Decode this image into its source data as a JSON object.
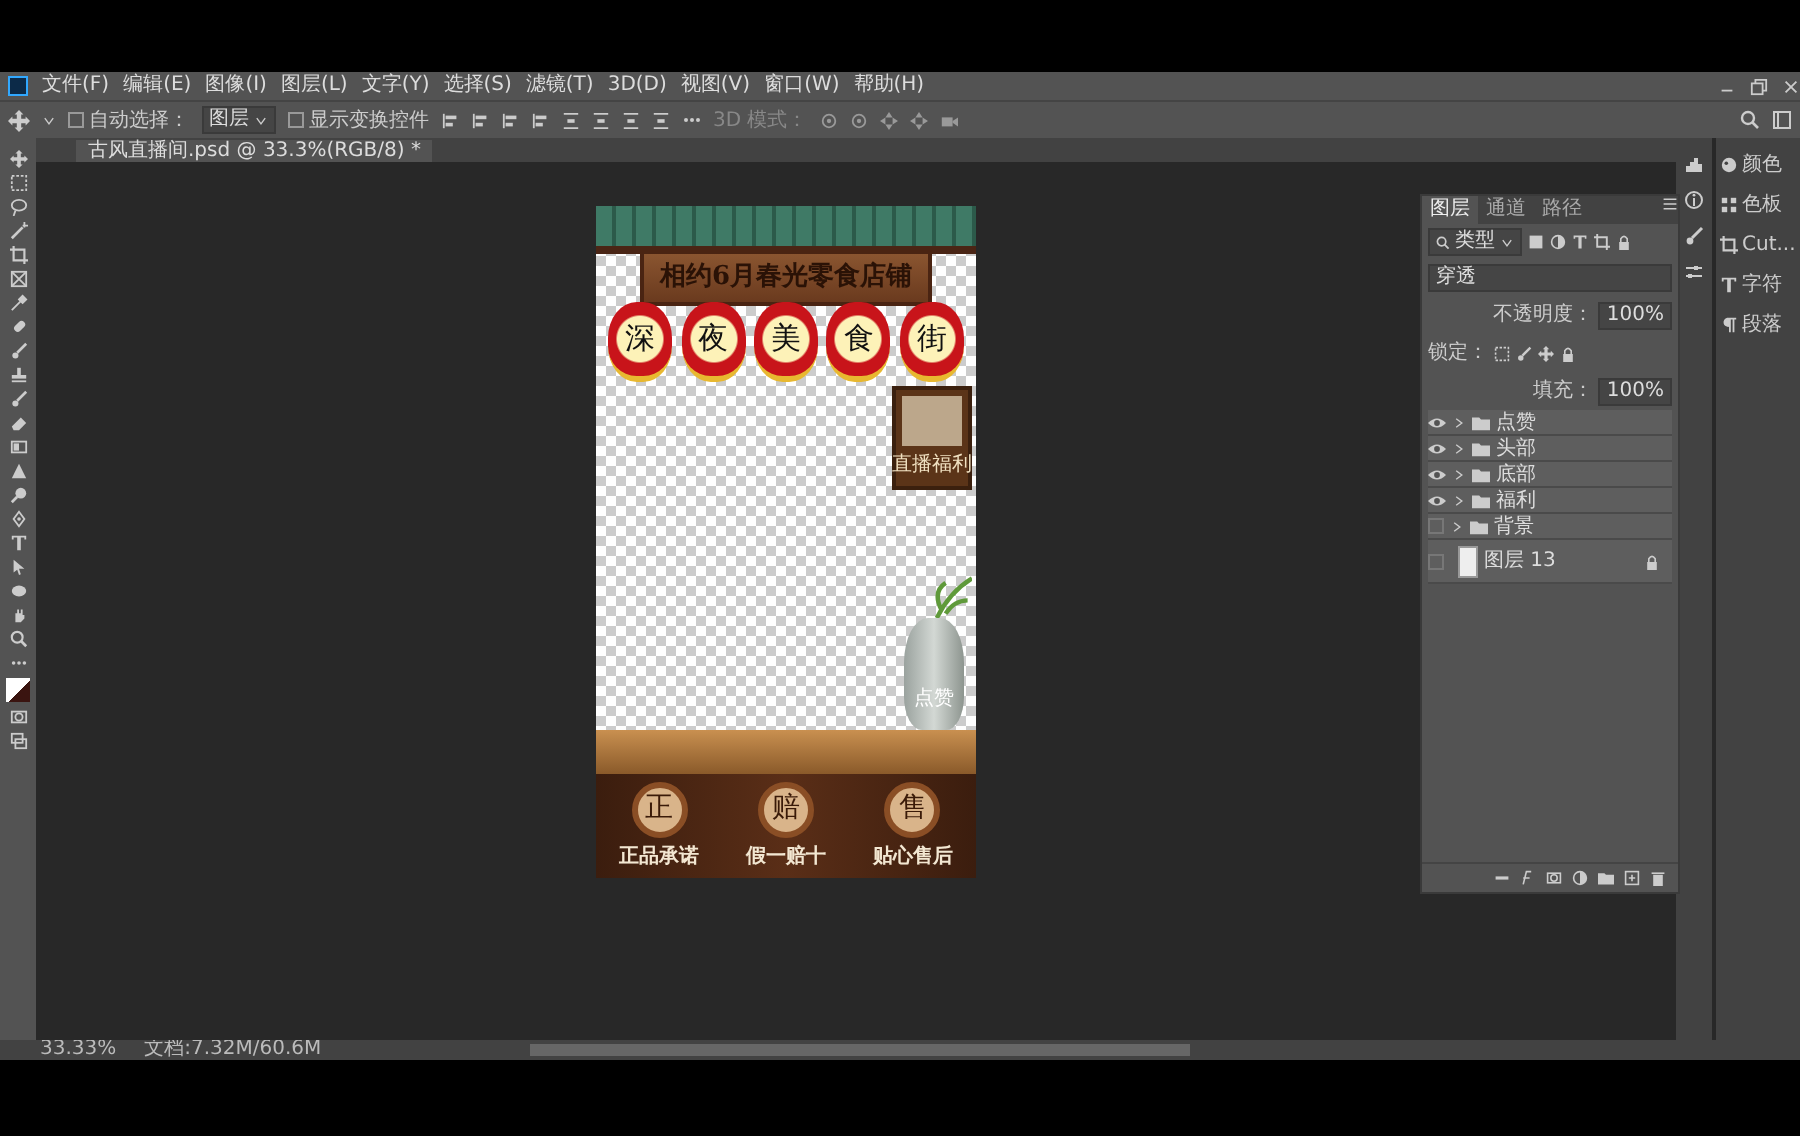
{
  "menu": [
    "文件(F)",
    "编辑(E)",
    "图像(I)",
    "图层(L)",
    "文字(Y)",
    "选择(S)",
    "滤镜(T)",
    "3D(D)",
    "视图(V)",
    "窗口(W)",
    "帮助(H)"
  ],
  "options": {
    "auto_select": {
      "label": "自动选择：",
      "checked": false
    },
    "target": "图层",
    "show_transform": {
      "label": "显示变换控件",
      "checked": false
    },
    "mode_label": "3D 模式："
  },
  "document_tab": "古风直播间.psd @ 33.3%(RGB/8) *",
  "design": {
    "title": "相约6月春光零食店铺",
    "lanterns": [
      "深",
      "夜",
      "美",
      "食",
      "街"
    ],
    "sign": "直播福利",
    "vase_label": "点赞",
    "badges": [
      {
        "character": "正",
        "caption": "正品承诺"
      },
      {
        "character": "赔",
        "caption": "假一赔十"
      },
      {
        "character": "售",
        "caption": "贴心售后"
      }
    ]
  },
  "layers_panel": {
    "tabs": [
      {
        "label": "图层",
        "selected": true
      },
      {
        "label": "通道",
        "selected": false
      },
      {
        "label": "路径",
        "selected": false
      }
    ],
    "filter": "类型",
    "blend": "穿透",
    "opacity_label": "不透明度：",
    "opacity": "100%",
    "lock_label": "锁定：",
    "fill_label": "填充：",
    "fill": "100%",
    "layers": [
      {
        "name": "点赞",
        "kind": "group",
        "visible": true,
        "locked": false
      },
      {
        "name": "头部",
        "kind": "group",
        "visible": true,
        "locked": false
      },
      {
        "name": "底部",
        "kind": "group",
        "visible": true,
        "locked": false
      },
      {
        "name": "福利",
        "kind": "group",
        "visible": true,
        "locked": false
      },
      {
        "name": "背景",
        "kind": "group",
        "visible": false,
        "locked": false
      },
      {
        "name": "图层 13",
        "kind": "layer",
        "visible": false,
        "locked": true
      }
    ]
  },
  "side_panels": [
    "颜色",
    "色板",
    "Cut...",
    "字符",
    "段落"
  ],
  "status_bar": {
    "zoom": "33.33%",
    "document": "文档:7.32M/60.6M"
  }
}
